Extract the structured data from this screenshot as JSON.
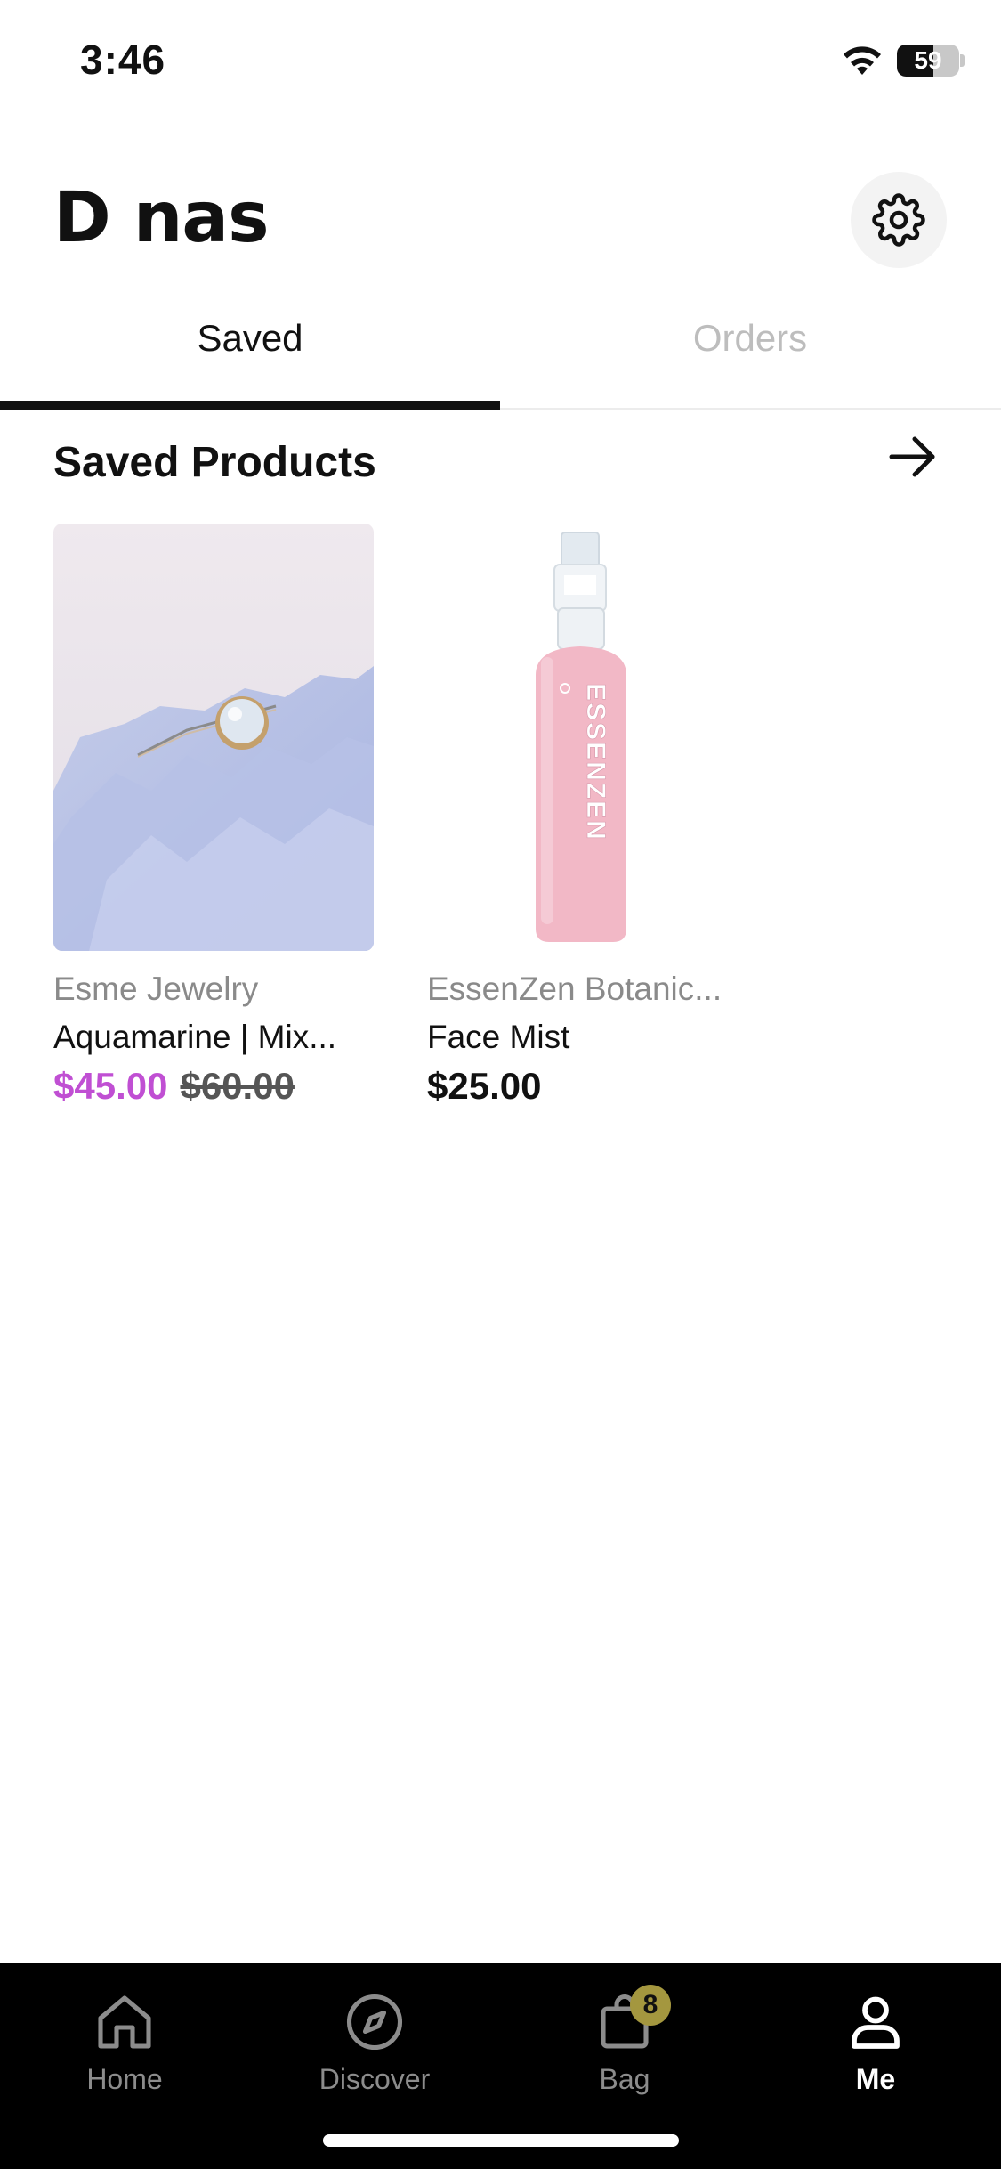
{
  "status_bar": {
    "time": "3:46",
    "battery": "59",
    "battery_level": 0.59
  },
  "header": {
    "title": "D nas"
  },
  "tabs": [
    {
      "label": "Saved",
      "active": true
    },
    {
      "label": "Orders",
      "active": false
    }
  ],
  "section": {
    "title": "Saved Products"
  },
  "products": [
    {
      "brand": "Esme Jewelry",
      "name": "Aquamarine | Mix...",
      "sale_price": "$45.00",
      "original_price": "$60.00"
    },
    {
      "brand": "EssenZen Botanic...",
      "name": "Face Mist",
      "price": "$25.00",
      "bottle_text": "ESSENZEN"
    }
  ],
  "bottom_nav": {
    "items": [
      {
        "label": "Home",
        "icon": "home-icon"
      },
      {
        "label": "Discover",
        "icon": "compass-icon"
      },
      {
        "label": "Bag",
        "icon": "bag-icon",
        "badge": "8"
      },
      {
        "label": "Me",
        "icon": "person-icon",
        "active": true
      }
    ]
  },
  "colors": {
    "sale_price": "#c04fd3",
    "inactive_tab": "#bdbdbd",
    "badge": "#a4973f",
    "nav_bg": "#000000"
  }
}
